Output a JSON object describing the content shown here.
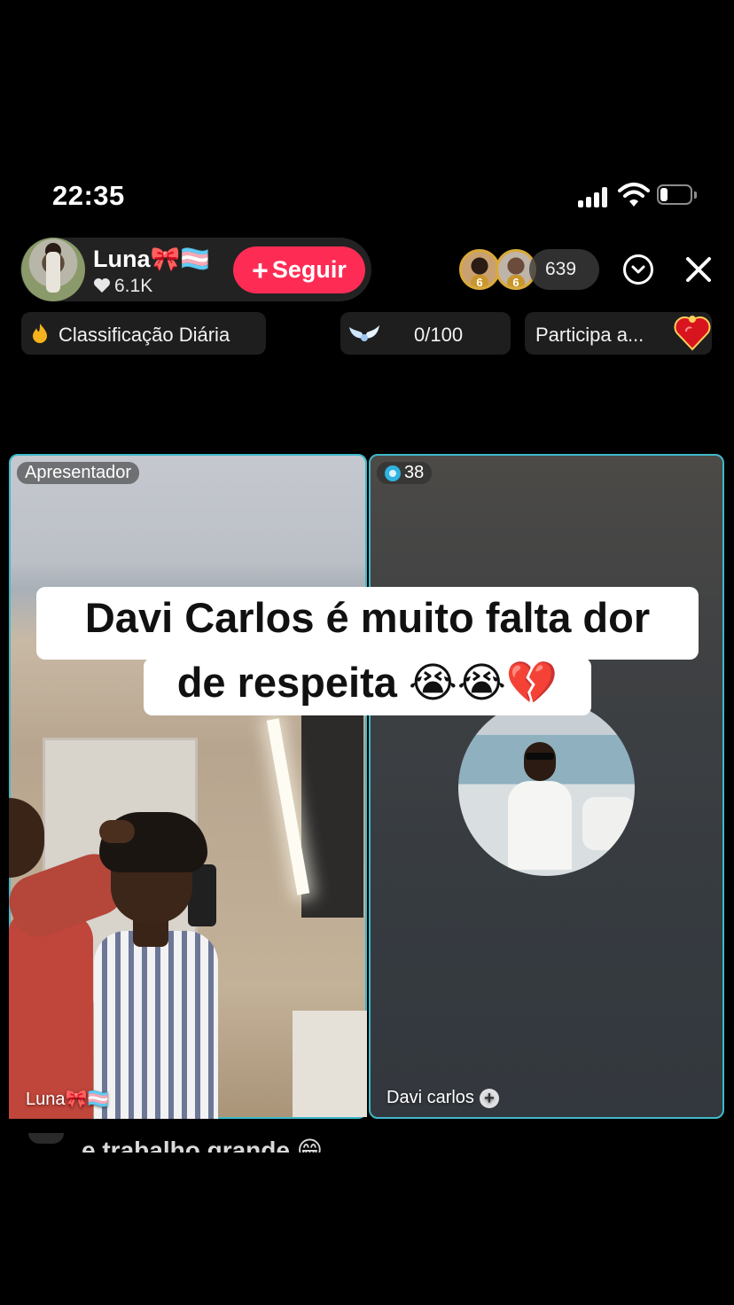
{
  "status_bar": {
    "time": "22:35"
  },
  "host": {
    "name": "Luna🎀🏳️‍⚧️",
    "likes": "6.1K",
    "follow_label": "Seguir"
  },
  "viewers": {
    "top_ranks": [
      "6",
      "6"
    ],
    "count": "639"
  },
  "badges": {
    "ranking_label": "Classificação Diária",
    "goal_progress": "0/100",
    "event_label": "Participa a..."
  },
  "panels": {
    "host_tag": "Apresentador",
    "guest_score": "38",
    "host_name": "Luna🎀🏳️‍⚧️",
    "guest_name": "Davi carlos"
  },
  "caption": {
    "line1": "Davi Carlos é muito falta dor",
    "line2": "de respeita 😭😭💔"
  },
  "comment": {
    "text": "e trabalho grande 😁"
  },
  "colors": {
    "follow_button": "#fe2c55",
    "panel_border": "#3fb8c9",
    "rank_gold": "#d9a93b"
  }
}
